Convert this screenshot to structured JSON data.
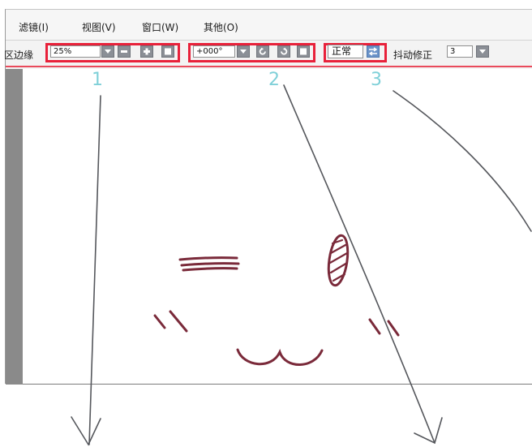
{
  "menu": {
    "filter": "滤镜(I)",
    "view": "视图(V)",
    "window": "窗口(W)",
    "other": "其他(O)"
  },
  "toolbar": {
    "edge_label": "区边缘",
    "zoom_value": "25%",
    "rotation_value": "+000°",
    "mode_value": "正常",
    "stabilizer_label": "抖动修正",
    "stabilizer_value": "3"
  },
  "annotations": {
    "n1": "1",
    "n2": "2",
    "n3": "3"
  },
  "icons": {
    "zoom_dropdown": "chevron-down-icon",
    "zoom_out": "minus-icon",
    "zoom_in": "plus-icon",
    "zoom_reset": "square-icon",
    "rotate_dropdown": "chevron-down-icon",
    "rotate_ccw": "rotate-left-icon",
    "rotate_cw": "rotate-right-icon",
    "rotate_reset": "square-icon",
    "flip": "flip-icon",
    "stabilizer_dropdown": "chevron-down-icon"
  },
  "colors": {
    "highlight": "#e8213a",
    "annotation": "#7fd0d8",
    "sketch": "#7a2a3a"
  }
}
